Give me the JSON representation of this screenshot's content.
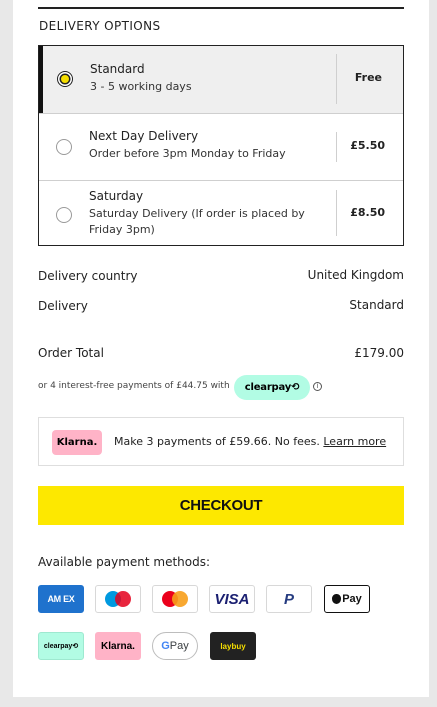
{
  "delivery_options": {
    "title": "DELIVERY OPTIONS",
    "options": [
      {
        "name": "Standard",
        "description": "3 - 5 working days",
        "price": "Free",
        "selected": true
      },
      {
        "name": "Next Day Delivery",
        "description": "Order before 3pm Monday to Friday",
        "price": "£5.50",
        "selected": false
      },
      {
        "name": "Saturday",
        "description": "Saturday Delivery (If order is placed by Friday 3pm)",
        "price": "£8.50",
        "selected": false
      }
    ]
  },
  "summary": {
    "country_label": "Delivery country",
    "country_value": "United Kingdom",
    "delivery_label": "Delivery",
    "delivery_value": "Standard",
    "total_label": "Order Total",
    "total_value": "£179.00"
  },
  "clearpay": {
    "text": "or 4 interest-free payments of £44.75 with",
    "badge": "clearpay⟲",
    "info_icon": "ⓘ"
  },
  "klarna": {
    "logo": "Klarna.",
    "text": "Make 3 payments of £59.66. No fees.",
    "link": "Learn more"
  },
  "checkout": {
    "label": "CHECKOUT"
  },
  "payment_methods": {
    "title": "Available payment methods:",
    "icons": {
      "amex": "AM EX",
      "visa": "VISA",
      "paypal": "P",
      "applepay": " Pay",
      "clearpay": "clearpay⟲",
      "klarna": "Klarna.",
      "gpay_g": "G",
      "gpay_text": " Pay",
      "laybuy": "laybuy"
    }
  },
  "colors": {
    "accent_yellow": "#fde800",
    "clearpay_mint": "#b2fce4",
    "klarna_pink": "#ffb3c7",
    "selected_bg": "#efefef"
  }
}
